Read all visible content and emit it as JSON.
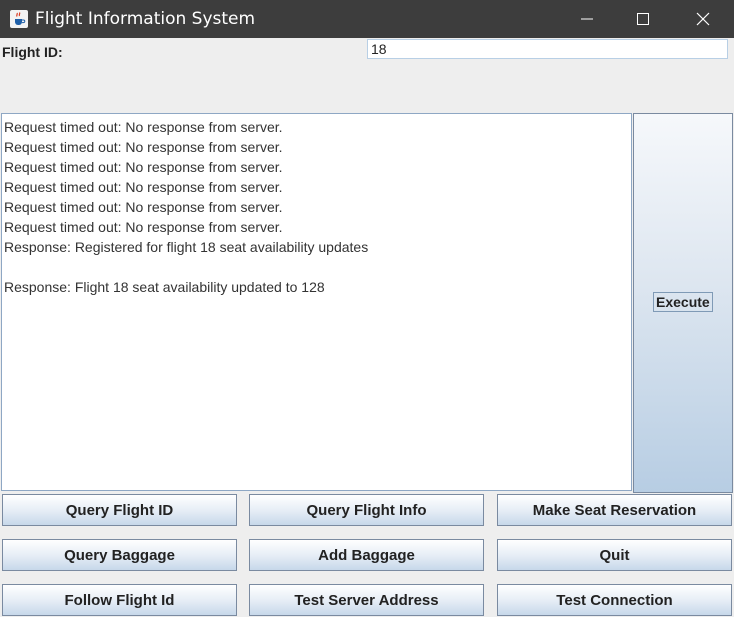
{
  "window": {
    "title": "Flight Information System"
  },
  "form": {
    "flight_id_label": "Flight ID:",
    "flight_id_value": "18"
  },
  "log": {
    "lines": [
      "Request timed out: No response from server.",
      "Request timed out: No response from server.",
      "Request timed out: No response from server.",
      "Request timed out: No response from server.",
      "Request timed out: No response from server.",
      "Request timed out: No response from server.",
      "Response: Registered for flight 18 seat availability updates",
      "",
      "Response: Flight 18 seat availability updated to 128"
    ]
  },
  "execute": {
    "label": "Execute"
  },
  "buttons": {
    "query_flight_id": "Query Flight ID",
    "query_flight_info": "Query Flight Info",
    "make_seat_reservation": "Make Seat Reservation",
    "query_baggage": "Query Baggage",
    "add_baggage": "Add Baggage",
    "quit": "Quit",
    "follow_flight_id": "Follow Flight Id",
    "test_server_address": "Test Server Address",
    "test_connection": "Test Connection"
  },
  "icons": {
    "app": "java-coffee-cup-icon",
    "minimize": "minimize-icon",
    "maximize": "maximize-icon",
    "close": "close-icon"
  }
}
